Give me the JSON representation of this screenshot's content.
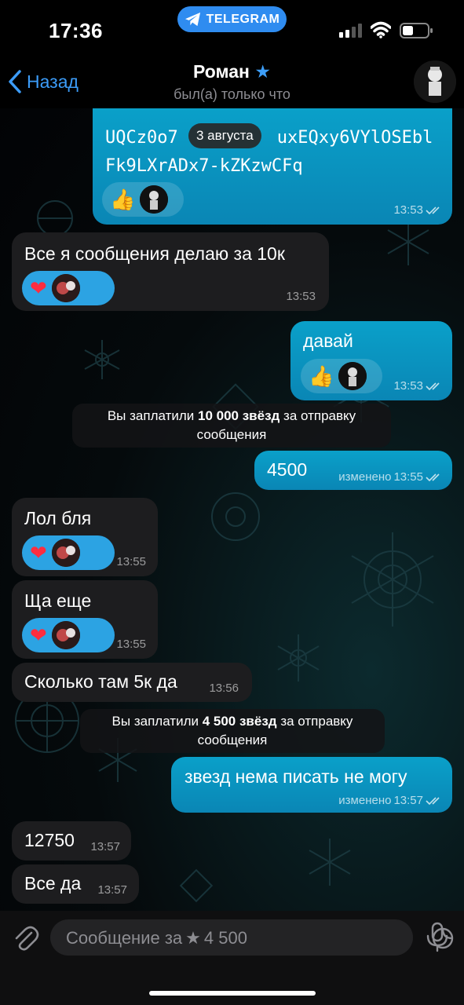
{
  "status_bar": {
    "time": "17:36",
    "pill_label": "TELEGRAM"
  },
  "header": {
    "back_label": "Назад",
    "title": "Роман",
    "subtitle": "был(а) только что"
  },
  "date_chip": "3 августа",
  "messages": [
    {
      "dir": "out",
      "text": "UQCz0o7Ti1Y6...uxEQxy6VYl0SEblFk9LXrADx7-kZKzwCFq",
      "line1": "UQCz0o7",
      "line1b": "uxEQxy6VYlOSEbl",
      "line2": "Fk9LXrADx7-kZKzwCFq",
      "time": "13:53",
      "reaction": "👍"
    },
    {
      "dir": "in",
      "text": "Все я сообщения делаю за 10к",
      "time": "13:53",
      "reaction": "❤️"
    },
    {
      "dir": "out",
      "text": "давай",
      "time": "13:53",
      "reaction": "👍"
    },
    {
      "dir": "out",
      "text": "4500",
      "edited": "изменено",
      "time": "13:55"
    },
    {
      "dir": "in",
      "text": "Лол бля",
      "time": "13:55",
      "reaction": "❤️"
    },
    {
      "dir": "in",
      "text": "Ща еще",
      "time": "13:55",
      "reaction": "❤️"
    },
    {
      "dir": "in",
      "text": "Сколько там 5к да",
      "time": "13:56"
    },
    {
      "dir": "out",
      "text": "звезд нема писать не могу",
      "edited": "изменено",
      "time": "13:57"
    },
    {
      "dir": "in",
      "text": "12750",
      "time": "13:57"
    },
    {
      "dir": "in",
      "text": "Все да",
      "time": "13:57"
    }
  ],
  "service_1": {
    "prefix": "Вы заплатили ",
    "bold": "10 000 звёзд",
    "suffix": " за отправку",
    "line2": "сообщения"
  },
  "service_2": {
    "prefix": "Вы заплатили ",
    "bold": "4 500 звёзд",
    "suffix": " за отправку",
    "line2": "сообщения"
  },
  "input": {
    "placeholder_prefix": "Сообщение за",
    "placeholder_amount": "4 500"
  },
  "colors": {
    "accent": "#3c9cf8",
    "outgoing": "#0a96c2",
    "incoming": "#1d1d1f",
    "reaction_in": "#2ca3e3"
  },
  "icons": [
    "paperclip-icon",
    "star-icon",
    "sticker-icon",
    "microphone-icon",
    "double-check-icon",
    "telegram-icon",
    "chevron-left-icon"
  ]
}
